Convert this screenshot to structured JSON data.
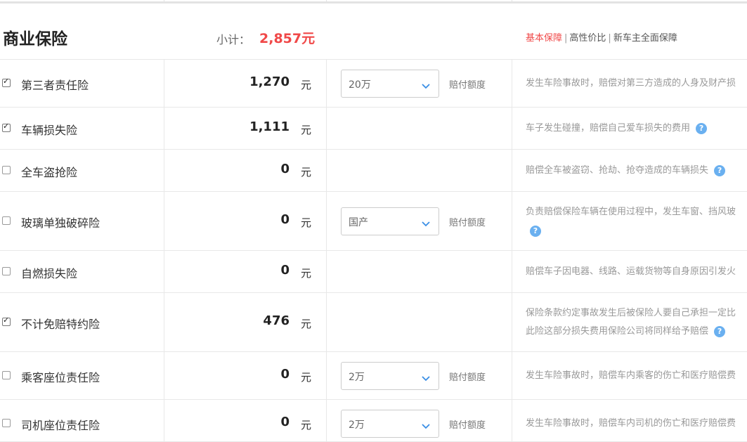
{
  "header": {
    "title": "商业保险",
    "subtotal_label": "小计：",
    "subtotal_value": "2,857元",
    "plans": [
      "基本保障",
      "高性价比",
      "新车主全面保障"
    ],
    "active_plan_color": "#f04848"
  },
  "rows": [
    {
      "checked": true,
      "name": "第三者责任险",
      "amount": "1,270",
      "unit": "元",
      "select": "20万",
      "limit_label": "赔付额度",
      "desc": [
        "发生车险事故时，赔偿对第三方造成的人身及财产损"
      ],
      "help": false
    },
    {
      "checked": true,
      "name": "车辆损失险",
      "amount": "1,111",
      "unit": "元",
      "select": null,
      "limit_label": null,
      "desc": [
        "车子发生碰撞，赔偿自己爱车损失的费用"
      ],
      "help": true
    },
    {
      "checked": false,
      "name": "全车盗抢险",
      "amount": "0",
      "unit": "元",
      "select": null,
      "limit_label": null,
      "desc": [
        "赔偿全车被盗窃、抢劫、抢夺造成的车辆损失"
      ],
      "help": true
    },
    {
      "checked": false,
      "name": "玻璃单独破碎险",
      "amount": "0",
      "unit": "元",
      "select": "国产",
      "limit_label": "赔付额度",
      "desc": [
        "负责赔偿保险车辆在使用过程中，发生车窗、挡风玻"
      ],
      "help": true
    },
    {
      "checked": false,
      "name": "自燃损失险",
      "amount": "0",
      "unit": "元",
      "select": null,
      "limit_label": null,
      "desc": [
        "赔偿车子因电器、线路、运载货物等自身原因引发火"
      ],
      "help": false
    },
    {
      "checked": true,
      "name": "不计免赔特约险",
      "amount": "476",
      "unit": "元",
      "select": null,
      "limit_label": null,
      "desc": [
        "保险条款约定事故发生后被保险人要自己承担一定比",
        "此险这部分损失费用保险公司将同样给予赔偿"
      ],
      "help": true
    },
    {
      "checked": false,
      "name": "乘客座位责任险",
      "amount": "0",
      "unit": "元",
      "select": "2万",
      "limit_label": "赔付额度",
      "desc": [
        "发生车险事故时，赔偿车内乘客的伤亡和医疗赔偿费"
      ],
      "help": false
    },
    {
      "checked": false,
      "name": "司机座位责任险",
      "amount": "0",
      "unit": "元",
      "select": "2万",
      "limit_label": "赔付额度",
      "desc": [
        "发生车险事故时，赔偿车内司机的伤亡和医疗赔偿费"
      ],
      "help": false
    }
  ],
  "icons": {
    "help": "question-circle-icon",
    "dropdown": "chevron-down-icon",
    "help_glyph": "?"
  }
}
